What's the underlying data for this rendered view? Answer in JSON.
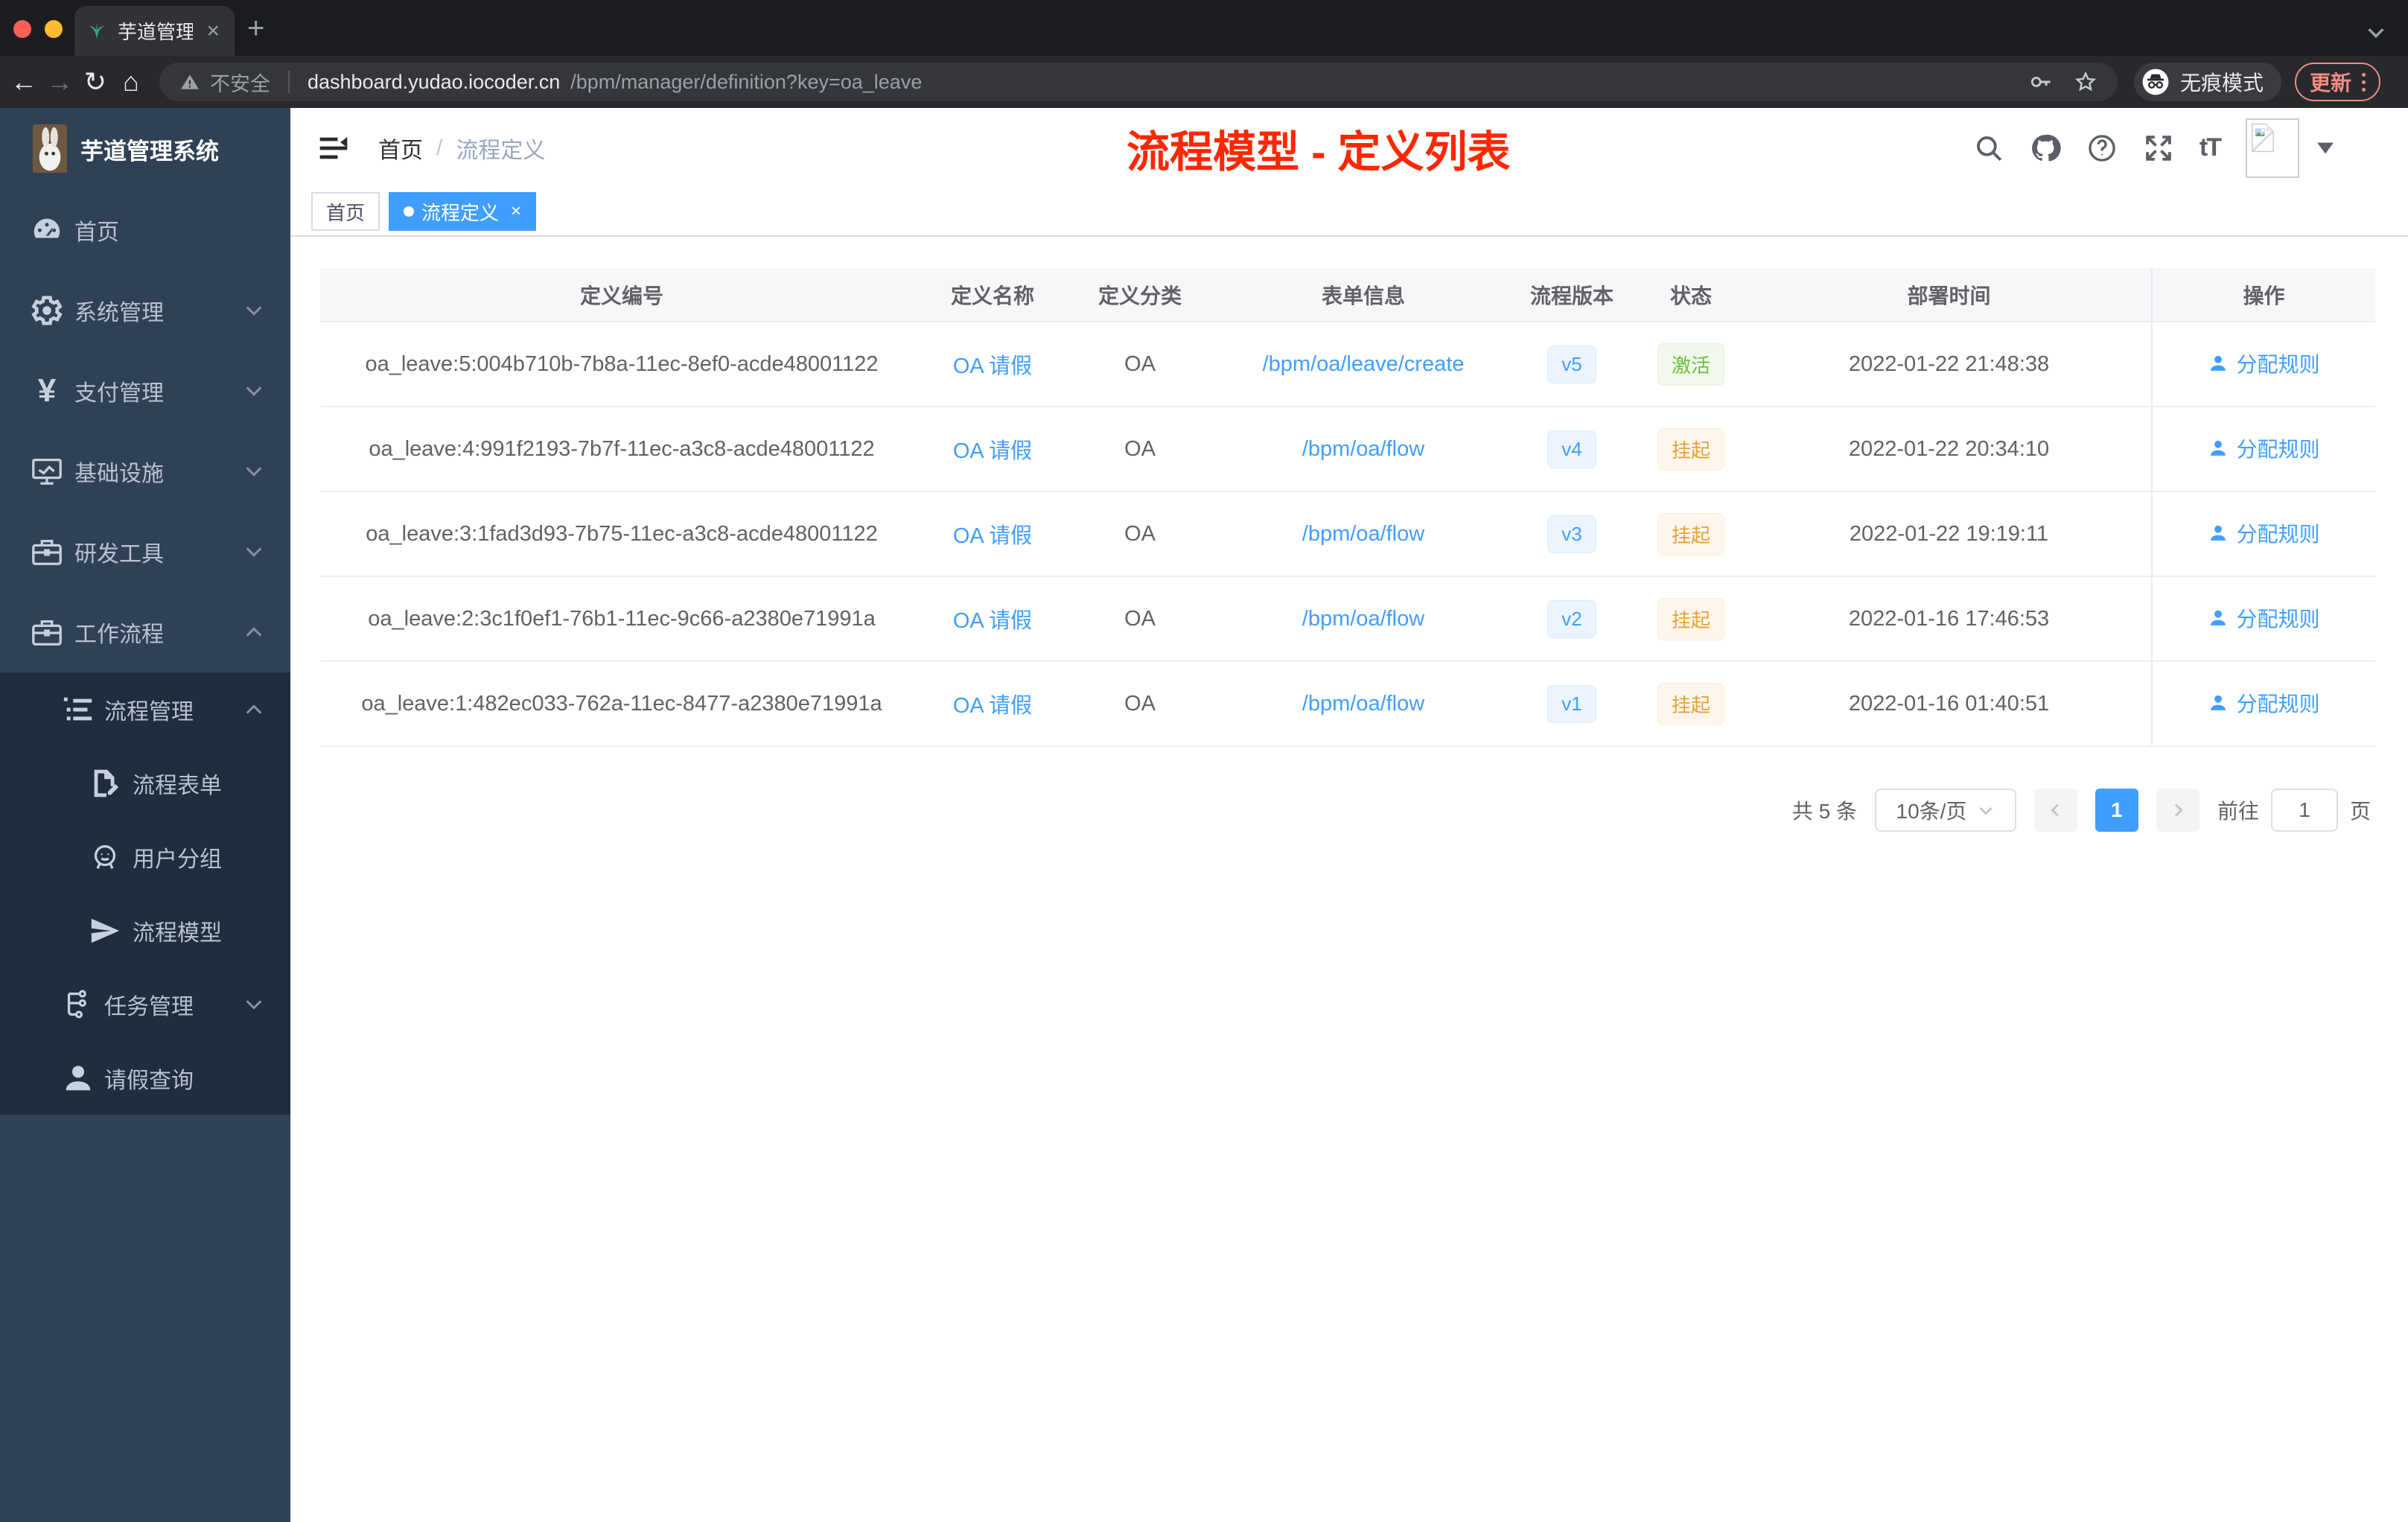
{
  "browser": {
    "tab_title": "芋道管理系统",
    "security_label": "不安全",
    "url_domain": "dashboard.yudao.iocoder.cn",
    "url_path": "/bpm/manager/definition?key=oa_leave",
    "incognito_label": "无痕模式",
    "update_label": "更新"
  },
  "sidebar": {
    "app_title": "芋道管理系统",
    "items": [
      {
        "label": "首页",
        "icon": "dashboard-icon",
        "level": 0,
        "in_sub": false,
        "arrow": null
      },
      {
        "label": "系统管理",
        "icon": "gear-icon",
        "level": 0,
        "in_sub": false,
        "arrow": "down"
      },
      {
        "label": "支付管理",
        "icon": "yen-icon",
        "level": 0,
        "in_sub": false,
        "arrow": "down"
      },
      {
        "label": "基础设施",
        "icon": "monitor-icon",
        "level": 0,
        "in_sub": false,
        "arrow": "down"
      },
      {
        "label": "研发工具",
        "icon": "toolbox-icon",
        "level": 0,
        "in_sub": false,
        "arrow": "down"
      },
      {
        "label": "工作流程",
        "icon": "briefcase-icon",
        "level": 0,
        "in_sub": false,
        "arrow": "up"
      },
      {
        "label": "流程管理",
        "icon": "list-icon",
        "level": 1,
        "in_sub": true,
        "arrow": "up"
      },
      {
        "label": "流程表单",
        "icon": "form-edit-icon",
        "level": 2,
        "in_sub": true,
        "arrow": null
      },
      {
        "label": "用户分组",
        "icon": "user-group-icon",
        "level": 2,
        "in_sub": true,
        "arrow": null
      },
      {
        "label": "流程模型",
        "icon": "send-icon",
        "level": 2,
        "in_sub": true,
        "arrow": null
      },
      {
        "label": "任务管理",
        "icon": "tree-icon",
        "level": 1,
        "in_sub": true,
        "arrow": "down"
      },
      {
        "label": "请假查询",
        "icon": "person-icon",
        "level": 1,
        "in_sub": true,
        "arrow": null
      }
    ]
  },
  "navbar": {
    "breadcrumb": [
      "首页",
      "流程定义"
    ],
    "breadcrumb_separator": "/",
    "annotation": "流程模型 - 定义列表",
    "action_icons": [
      "search-icon",
      "github-icon",
      "help-icon",
      "fullscreen-icon",
      "font-size-icon"
    ]
  },
  "tags": [
    {
      "label": "首页",
      "active": false,
      "closable": false
    },
    {
      "label": "流程定义",
      "active": true,
      "closable": true
    }
  ],
  "table": {
    "columns": [
      "定义编号",
      "定义名称",
      "定义分类",
      "表单信息",
      "流程版本",
      "状态",
      "部署时间",
      "操作"
    ],
    "rows": [
      {
        "id": "oa_leave:5:004b710b-7b8a-11ec-8ef0-acde48001122",
        "name": "OA 请假",
        "category": "OA",
        "form": "/bpm/oa/leave/create",
        "version": "v5",
        "status": "激活",
        "status_type": "success",
        "time": "2022-01-22 21:48:38",
        "action": "分配规则"
      },
      {
        "id": "oa_leave:4:991f2193-7b7f-11ec-a3c8-acde48001122",
        "name": "OA 请假",
        "category": "OA",
        "form": "/bpm/oa/flow",
        "version": "v4",
        "status": "挂起",
        "status_type": "warning",
        "time": "2022-01-22 20:34:10",
        "action": "分配规则"
      },
      {
        "id": "oa_leave:3:1fad3d93-7b75-11ec-a3c8-acde48001122",
        "name": "OA 请假",
        "category": "OA",
        "form": "/bpm/oa/flow",
        "version": "v3",
        "status": "挂起",
        "status_type": "warning",
        "time": "2022-01-22 19:19:11",
        "action": "分配规则"
      },
      {
        "id": "oa_leave:2:3c1f0ef1-76b1-11ec-9c66-a2380e71991a",
        "name": "OA 请假",
        "category": "OA",
        "form": "/bpm/oa/flow",
        "version": "v2",
        "status": "挂起",
        "status_type": "warning",
        "time": "2022-01-16 17:46:53",
        "action": "分配规则"
      },
      {
        "id": "oa_leave:1:482ec033-762a-11ec-8477-a2380e71991a",
        "name": "OA 请假",
        "category": "OA",
        "form": "/bpm/oa/flow",
        "version": "v1",
        "status": "挂起",
        "status_type": "warning",
        "time": "2022-01-16 01:40:51",
        "action": "分配规则"
      }
    ]
  },
  "pagination": {
    "total_label": "共 5 条",
    "page_size": "10条/页",
    "current_page": "1",
    "goto_label": "前往",
    "goto_value": "1",
    "page_unit": "页"
  },
  "colors": {
    "accent_blue": "#409eff",
    "annotation_red": "#ff2600",
    "status_active_green": "#67c23a",
    "status_suspended_orange": "#e6a23c",
    "sidebar_bg": "#304156",
    "submenu_bg": "#1f2d3d",
    "traffic_red": "#ff5f57",
    "traffic_yellow": "#febc2e",
    "traffic_green": "#2ac840"
  }
}
